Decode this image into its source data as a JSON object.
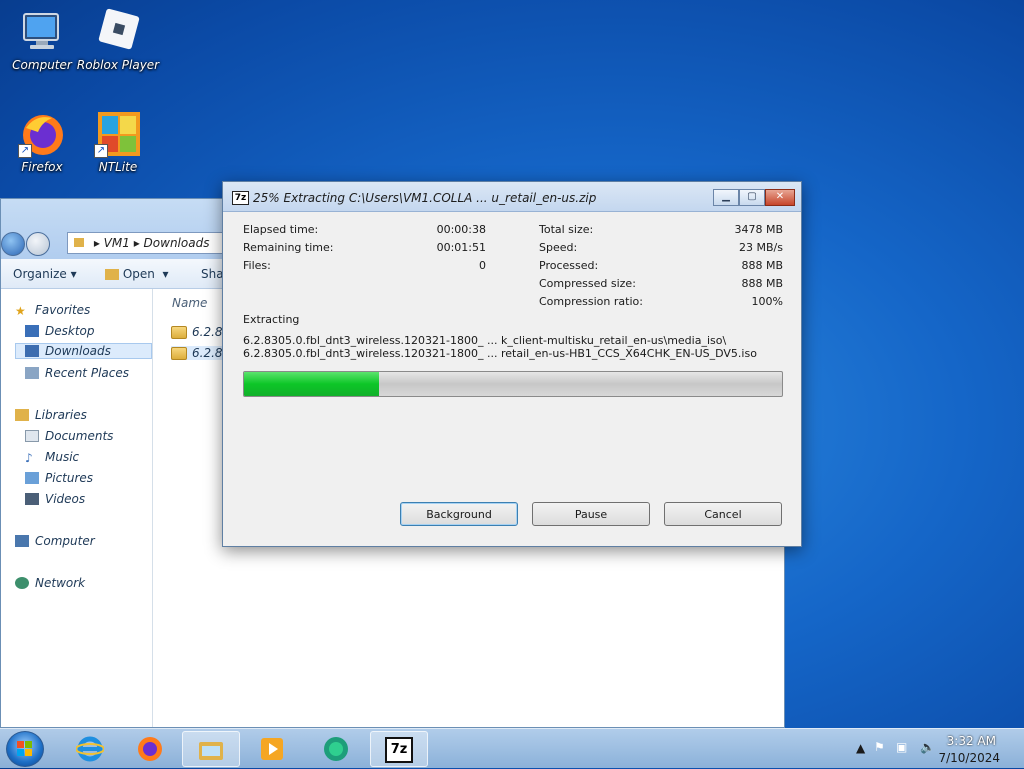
{
  "desktop": {
    "icons": [
      {
        "label": "Computer"
      },
      {
        "label": "Roblox Player"
      },
      {
        "label": "Firefox"
      },
      {
        "label": "NTLite"
      }
    ]
  },
  "explorer": {
    "breadcrumb": [
      "VM1",
      "Downloads"
    ],
    "toolbar": {
      "organize": "Organize",
      "open": "Open",
      "share": "Shar"
    },
    "nav": {
      "favorites": "Favorites",
      "desktop": "Desktop",
      "downloads": "Downloads",
      "recent_places": "Recent Places",
      "libraries": "Libraries",
      "documents": "Documents",
      "music": "Music",
      "pictures": "Pictures",
      "videos": "Videos",
      "computer": "Computer",
      "network": "Network"
    },
    "column_name": "Name",
    "files": [
      {
        "name": "6.2.83"
      },
      {
        "name": "6.2.83"
      }
    ]
  },
  "dialog": {
    "title": "25% Extracting C:\\Users\\VM1.COLLA ... u_retail_en-us.zip",
    "title_icon": "7z",
    "stats_left": [
      {
        "label": "Elapsed time:",
        "value": "00:00:38"
      },
      {
        "label": "Remaining time:",
        "value": "00:01:51"
      },
      {
        "label": "Files:",
        "value": "0"
      }
    ],
    "stats_right": [
      {
        "label": "Total size:",
        "value": "3478 MB"
      },
      {
        "label": "Speed:",
        "value": "23 MB/s"
      },
      {
        "label": "Processed:",
        "value": "888 MB"
      },
      {
        "label": "Compressed size:",
        "value": "888 MB"
      },
      {
        "label": "Compression ratio:",
        "value": "100%"
      }
    ],
    "operation": "Extracting",
    "path_line1": "6.2.8305.0.fbl_dnt3_wireless.120321-1800_ ... k_client-multisku_retail_en-us\\media_iso\\",
    "path_line2": "6.2.8305.0.fbl_dnt3_wireless.120321-1800_ ... retail_en-us-HB1_CCS_X64CHK_EN-US_DV5.iso",
    "progress_percent": 25,
    "buttons": {
      "background": "Background",
      "pause": "Pause",
      "cancel": "Cancel"
    }
  },
  "taskbar": {
    "clock_time": "3:32 AM",
    "clock_date": "7/10/2024",
    "seven_zip_label": "7z"
  },
  "colors": {
    "progress_fill": "#0dc627",
    "desktop_bg": "#1566c8"
  }
}
